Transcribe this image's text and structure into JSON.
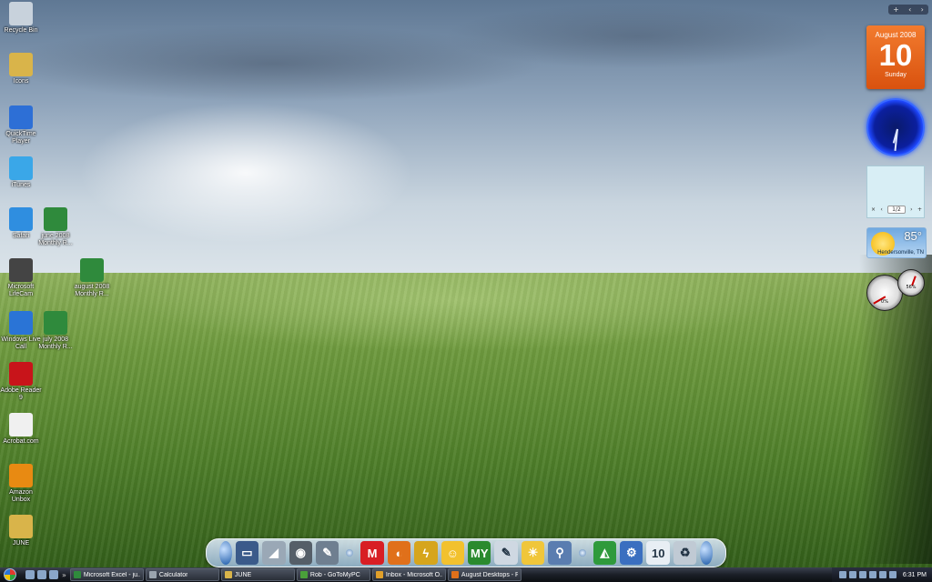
{
  "desktop": {
    "icons": [
      {
        "label": "Recycle Bin",
        "icon": "recycle-bin-icon",
        "color": "#c8d2dc"
      },
      {
        "label": "Icons",
        "icon": "folder-icon",
        "color": "#d9b44a"
      },
      {
        "label": "QuickTime Player",
        "icon": "quicktime-icon",
        "color": "#2d6fd6"
      },
      {
        "label": "iTunes",
        "icon": "itunes-icon",
        "color": "#3aa7e8"
      },
      {
        "label": "Safari",
        "icon": "safari-icon",
        "color": "#2f8ee0"
      },
      {
        "label": "june 2008 Monthly R...",
        "icon": "excel-file-icon",
        "color": "#2f8a3c"
      },
      {
        "label": "Microsoft LifeCam",
        "icon": "webcam-icon",
        "color": "#444444"
      },
      {
        "label": "august 2008 Monthly R...",
        "icon": "excel-file-icon",
        "color": "#2f8a3c"
      },
      {
        "label": "Windows Live Call",
        "icon": "windows-live-call-icon",
        "color": "#2a74d6"
      },
      {
        "label": "july 2008 Monthly R...",
        "icon": "excel-file-icon",
        "color": "#2f8a3c"
      },
      {
        "label": "Adobe Reader 9",
        "icon": "adobe-reader-icon",
        "color": "#c8141a"
      },
      {
        "label": "Acrobat.com",
        "icon": "acrobat-com-icon",
        "color": "#f0f0f0"
      },
      {
        "label": "Amazon Unbox",
        "icon": "amazon-unbox-icon",
        "color": "#e88a12"
      },
      {
        "label": "JUNE",
        "icon": "folder-icon",
        "color": "#d9b44a"
      }
    ]
  },
  "sidebar": {
    "controls": [
      "+",
      "‹",
      "›"
    ],
    "calendar": {
      "month": "August 2008",
      "day": "10",
      "weekday": "Sunday"
    },
    "clock": {
      "hours": 6,
      "minutes": 31
    },
    "notes": {
      "page": "1/2",
      "prev": "‹",
      "next": "›",
      "close": "×",
      "add": "+"
    },
    "weather": {
      "temp": "85°",
      "city": "Hendersonville, TN"
    },
    "cpu_meter": {
      "cpu": "0%",
      "memory": "56%"
    }
  },
  "dock": {
    "items": [
      {
        "name": "monitor",
        "icon": "monitor-icon",
        "color": "#3a5a8a",
        "glyph": "▭"
      },
      {
        "name": "cleaner",
        "icon": "cleaner-icon",
        "color": "#9aa8b6",
        "glyph": "◢"
      },
      {
        "name": "camera",
        "icon": "camera-icon",
        "color": "#555e68",
        "glyph": "◉"
      },
      {
        "name": "tools",
        "icon": "tools-icon",
        "color": "#6f7f90",
        "glyph": "✎"
      },
      {
        "name": "mcafee",
        "icon": "mcafee-icon",
        "color": "#d81e24",
        "glyph": "M"
      },
      {
        "name": "firefox",
        "icon": "firefox-icon",
        "color": "#e0701a",
        "glyph": "◐"
      },
      {
        "name": "flash",
        "icon": "flash-icon",
        "color": "#d6a51c",
        "glyph": "ϟ"
      },
      {
        "name": "yahoo-messenger",
        "icon": "yahoo-messenger-icon",
        "color": "#f2c12e",
        "glyph": "☺"
      },
      {
        "name": "mypc",
        "icon": "mypc-icon",
        "color": "#2a8a2e",
        "glyph": "MY"
      },
      {
        "name": "notes",
        "icon": "notepad-icon",
        "color": "#cfd8e2",
        "glyph": "✎"
      },
      {
        "name": "weather",
        "icon": "weather-icon",
        "color": "#f0c63a",
        "glyph": "☀"
      },
      {
        "name": "search",
        "icon": "magnifier-icon",
        "color": "#5a7db0",
        "glyph": "⚲"
      },
      {
        "name": "crocodile",
        "icon": "crocodile-icon",
        "color": "#2f9a3c",
        "glyph": "◭"
      },
      {
        "name": "settings",
        "icon": "gear-icon",
        "color": "#3a6fc0",
        "glyph": "⚙"
      },
      {
        "name": "calendar",
        "icon": "calendar-icon",
        "color": "#e8eef4",
        "glyph": "10"
      },
      {
        "name": "trash",
        "icon": "trash-icon",
        "color": "#c0cad4",
        "glyph": "♻"
      }
    ]
  },
  "taskbar": {
    "more": "»",
    "tasks": [
      {
        "label": "Microsoft Excel - ju...",
        "icon": "excel-icon",
        "color": "#2f8a3c"
      },
      {
        "label": "Calculator",
        "icon": "calculator-icon",
        "color": "#9aa4ae"
      },
      {
        "label": "JUNE",
        "icon": "folder-icon",
        "color": "#d9b44a"
      },
      {
        "label": "Rob - GoToMyPC",
        "icon": "gotomypc-icon",
        "color": "#4aa03a"
      },
      {
        "label": "Inbox - Microsoft O...",
        "icon": "outlook-icon",
        "color": "#e0a02a"
      },
      {
        "label": "August Desktops - P...",
        "icon": "firefox-icon",
        "color": "#e0701a"
      }
    ],
    "time": "6:31 PM"
  }
}
